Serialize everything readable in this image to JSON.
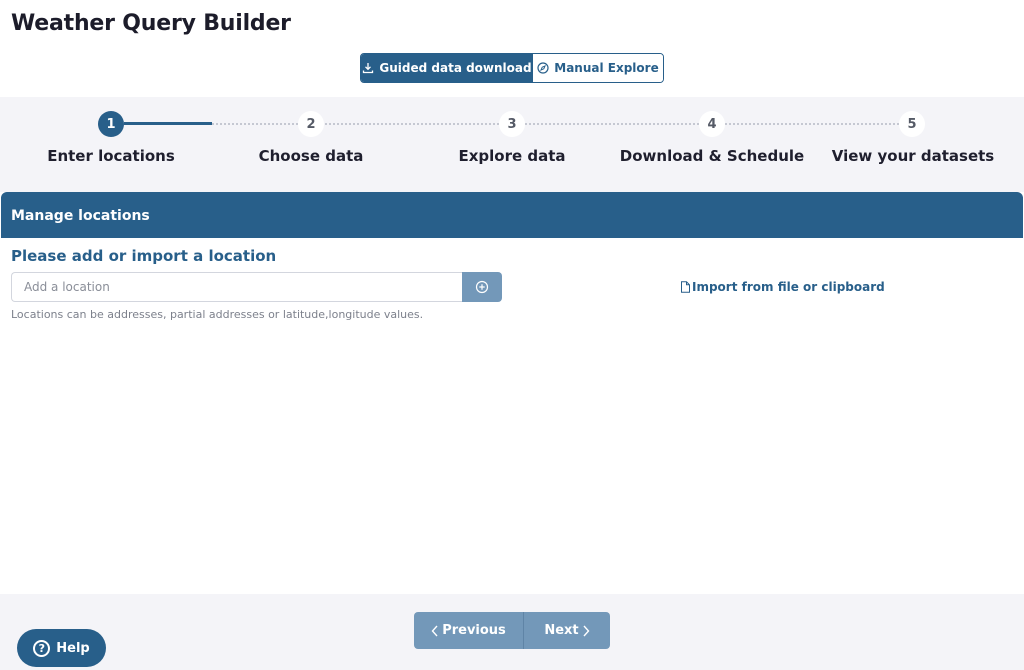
{
  "app": {
    "title": "Weather Query Builder"
  },
  "mode_toggle": {
    "guided_label": "Guided data download",
    "guided_icon": "download-icon",
    "manual_label": "Manual Explore",
    "manual_icon": "compass-icon"
  },
  "steps": [
    {
      "number": "1",
      "label": "Enter locations",
      "active": true
    },
    {
      "number": "2",
      "label": "Choose data",
      "active": false
    },
    {
      "number": "3",
      "label": "Explore data",
      "active": false
    },
    {
      "number": "4",
      "label": "Download & Schedule",
      "active": false
    },
    {
      "number": "5",
      "label": "View your datasets",
      "active": false
    }
  ],
  "panel": {
    "header": "Manage locations",
    "section_title": "Please add or import a location",
    "input_placeholder": "Add a location",
    "input_value": "",
    "add_icon": "plus-circle-icon",
    "hint": "Locations can be addresses, partial addresses or latitude,longitude values.",
    "import_label": "Import from file or clipboard",
    "import_icon": "file-icon"
  },
  "footer": {
    "previous_label": "Previous",
    "next_label": "Next",
    "help_label": "Help"
  },
  "colors": {
    "primary": "#285f8a",
    "disabled": "#7398b9",
    "stepper_bg": "#f4f4f8"
  }
}
